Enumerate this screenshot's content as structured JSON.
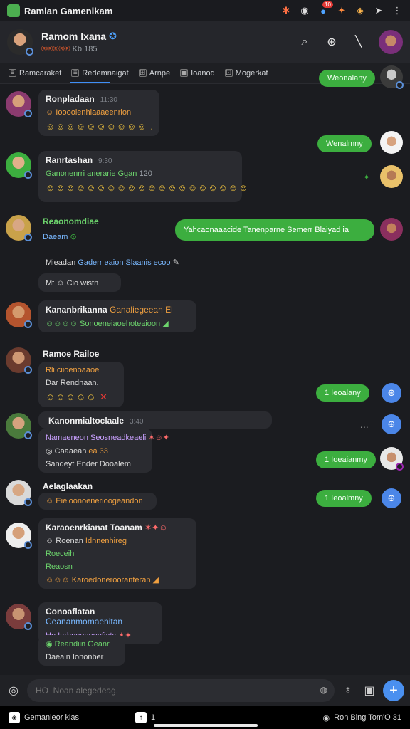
{
  "status": {
    "title": "Ramlan Gamenikam",
    "notif_count": "10",
    "icons": [
      "tool-icon",
      "record-icon",
      "notification-icon",
      "flame-icon",
      "shield-icon",
      "send-icon",
      "more-icon"
    ]
  },
  "header": {
    "name": "Ramom Ixana",
    "sub_accent": "®®®®®",
    "sub_muted": "Kb 185"
  },
  "tabs": [
    {
      "label": "Ramcaraket"
    },
    {
      "label": "Redemnaigat"
    },
    {
      "label": "Arnpe"
    },
    {
      "label": "Ioanod"
    },
    {
      "label": "Mogerkat"
    }
  ],
  "messages": {
    "m1": {
      "sender": "Ronpladaan",
      "time": "11:30",
      "line1": "Iooooienhiaaaeenrion",
      "emoji": "☺☺☺☺☺☺☺☺☺☺ ."
    },
    "m2": {
      "sender": "Ranrtashan",
      "time": "9:30",
      "line1": "Ganonenrri anerarie Ggan",
      "line1b": "120",
      "emoji": "☺☺☺☺☺☺☺☺☺☺☺☺☺☺☺☺☺☺☺☺"
    },
    "m3": {
      "sender": "Reaonomdiae",
      "line1": "Daeam",
      "line2a": "Mieadan",
      "line2b": "Gaderr eaion Slaanis ecoo",
      "line3": "Mt ☺ Cio wistn"
    },
    "m4": {
      "sender": "Kananbrikanna",
      "tag": "Ganaliegeean El",
      "line1": "Sonoeneiaoehoteaioon"
    },
    "m5": {
      "sender": "Ramoe Railoe",
      "line1": "Rli ciioenoaaoe",
      "line2": "Dar Rendnaan."
    },
    "m6": {
      "sender": "Kanonmialtoclaale",
      "time": "3:40",
      "line1": "Namaeneon Seosneadkeaeli",
      "line2": "Caaaean",
      "line2b": "ea 33",
      "line3": "Sandeyt Ender Dooalem"
    },
    "m7": {
      "sender": "Aelaglaakan",
      "line1": "Eieloonoenerioogeandon"
    },
    "m8": {
      "sender": "Karaoenrkianat Toanam",
      "line1": "Roenan",
      "line1b": "Idnnenhireg",
      "line2": "Roeceih",
      "line3": "Reaosn",
      "line4": "Karoedonerooranteran"
    },
    "m9": {
      "sender": "Conoaflatan",
      "tag": "Ceananmomaenitan",
      "line1": "Hn Iarhnoeonoofiats",
      "line2": "Reandiin Geanr",
      "line3": "Daeain Iononber"
    }
  },
  "right": {
    "p1": "Weonalany",
    "p2": "Wenalmny",
    "wide": "Yahcaonaaacide Tanenparne Semerr Blaiyad ia",
    "p3": "1 Ieoalany",
    "p4": "1 Ioeaianmy",
    "p5": "1 Ieoalmny",
    "ellipsis": "..."
  },
  "composer": {
    "placeholder": "HO  Noan alegedeag."
  },
  "navbar": {
    "left": "Gemanieor kias",
    "mid": "1",
    "right": "Ron Bing Tom'O 31"
  },
  "colors": {
    "accent": "#3cae3f",
    "blue": "#4b86e8",
    "bg": "#1b1c20"
  }
}
